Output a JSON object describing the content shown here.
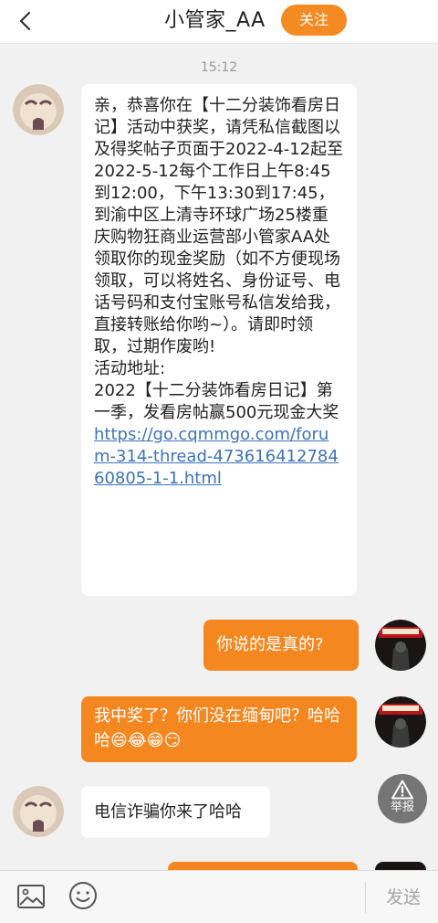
{
  "header": {
    "title": "小管家_AA",
    "follow_label": "关注",
    "back_icon": "chevron-left-icon"
  },
  "chat": {
    "timestamp": "15:12",
    "messages": [
      {
        "side": "left",
        "text": "亲，恭喜你在【十二分装饰看房日记】活动中获奖，请凭私信截图以及得奖帖子页面于2022-4-12起至2022-5-12每个工作日上午8:45到12:00，下午13:30到17:45，到渝中区上清寺环球广场25楼重庆购物狂商业运营部小管家AA处领取你的现金奖励（如不方便现场领取，可以将姓名、身份证号、电话号码和支付宝账号私信发给我，直接转账给你哟~）。请即时领取，过期作废哟!\n活动地址:\n2022【十二分装饰看房日记】第一季，发看房帖赢500元现金大奖",
        "link": "https://go.cqmmgo.com/forum-314-thread-47361641278460805-1-1.html"
      },
      {
        "side": "right",
        "text": "你说的是真的?"
      },
      {
        "side": "right",
        "text": "我中奖了？你们没在缅甸吧？哈哈哈😄😂😁😏"
      },
      {
        "side": "left",
        "text": "电信诈骗你来了哈哈"
      }
    ]
  },
  "report": {
    "label": "举报",
    "icon": "warning-icon"
  },
  "bottombar": {
    "image_icon": "image-icon",
    "emoji_icon": "emoji-icon",
    "send_label": "发送"
  },
  "colors": {
    "accent": "#f4871f",
    "link": "#3d73b8",
    "background": "#f1f1f1"
  }
}
